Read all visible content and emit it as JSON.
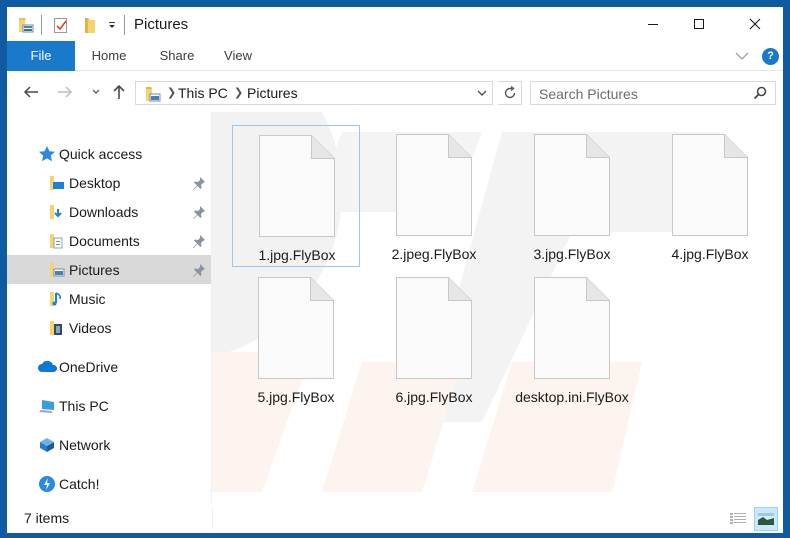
{
  "window": {
    "title": "Pictures",
    "accent": "#1979ca",
    "frame_color": "#0f5aa0"
  },
  "quick_access_toolbar": {
    "icons": [
      "properties-icon",
      "new-folder-icon",
      "customize-dropdown-icon"
    ]
  },
  "ribbon": {
    "tabs": [
      {
        "label": "File",
        "active": true
      },
      {
        "label": "Home"
      },
      {
        "label": "Share"
      },
      {
        "label": "View"
      }
    ],
    "help_label": "?"
  },
  "address_bar": {
    "breadcrumbs": [
      "This PC",
      "Pictures"
    ],
    "search_placeholder": "Search Pictures"
  },
  "sidebar": {
    "items": [
      {
        "label": "Quick access",
        "icon": "star-icon",
        "level": 0
      },
      {
        "label": "Desktop",
        "icon": "desktop-folder-icon",
        "level": 1,
        "pinned": true
      },
      {
        "label": "Downloads",
        "icon": "downloads-folder-icon",
        "level": 1,
        "pinned": true
      },
      {
        "label": "Documents",
        "icon": "documents-folder-icon",
        "level": 1,
        "pinned": true
      },
      {
        "label": "Pictures",
        "icon": "pictures-folder-icon",
        "level": 1,
        "pinned": true,
        "selected": true
      },
      {
        "label": "Music",
        "icon": "music-folder-icon",
        "level": 1
      },
      {
        "label": "Videos",
        "icon": "videos-folder-icon",
        "level": 1
      },
      {
        "label": "OneDrive",
        "icon": "onedrive-icon",
        "level": 0
      },
      {
        "label": "This PC",
        "icon": "this-pc-icon",
        "level": 0
      },
      {
        "label": "Network",
        "icon": "network-icon",
        "level": 0
      },
      {
        "label": "Catch!",
        "icon": "catch-icon",
        "level": 0
      }
    ]
  },
  "files": [
    {
      "name": "1.jpg.FlyBox",
      "focused": true
    },
    {
      "name": "2.jpeg.FlyBox"
    },
    {
      "name": "3.jpg.FlyBox"
    },
    {
      "name": "4.jpg.FlyBox"
    },
    {
      "name": "5.jpg.FlyBox"
    },
    {
      "name": "6.jpg.FlyBox"
    },
    {
      "name": "desktop.ini.FlyBox"
    }
  ],
  "status_bar": {
    "item_count": "7 items",
    "views": [
      "details-view",
      "large-icons-view"
    ],
    "active_view": "large-icons-view"
  }
}
